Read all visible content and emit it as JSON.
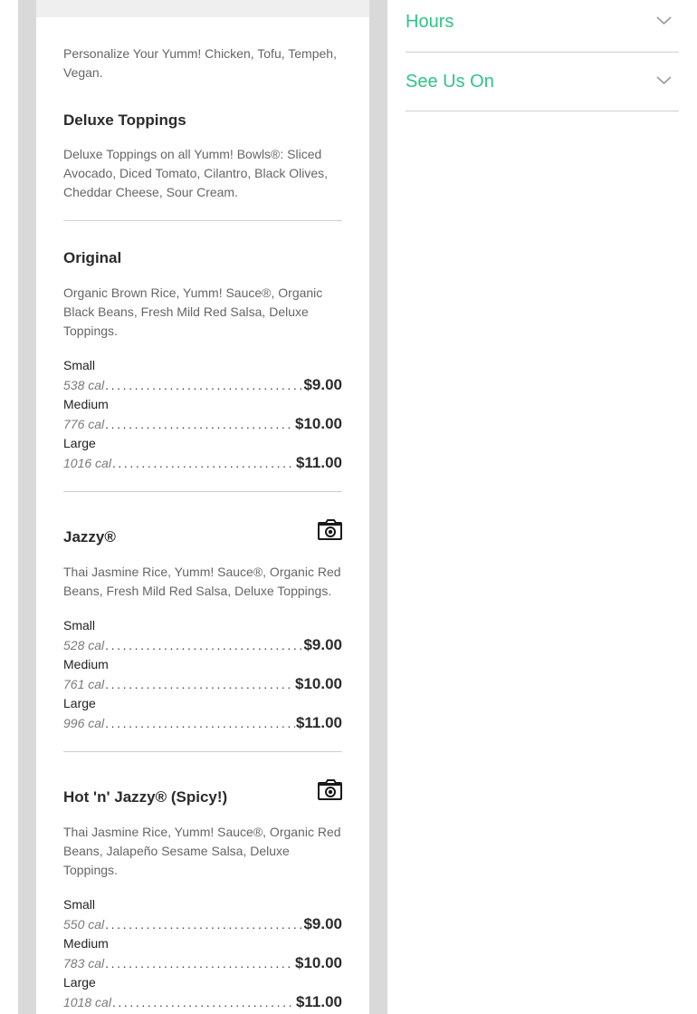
{
  "menu": {
    "intro": "Personalize Your Yumm! Chicken, Tofu, Tempeh, Vegan.",
    "toppings": {
      "title": "Deluxe Toppings",
      "description": "Deluxe Toppings on all Yumm! Bowls®: Sliced Avocado, Diced Tomato, Cilantro, Black Olives, Cheddar Cheese, Sour Cream."
    },
    "items": [
      {
        "name": "Original",
        "description": "Organic Brown Rice, Yumm! Sauce®, Organic Black Beans, Fresh Mild Red Salsa, Deluxe Toppings.",
        "has_photo": false,
        "sizes": [
          {
            "label": "Small",
            "cal": "538 cal",
            "price": "$9.00"
          },
          {
            "label": "Medium",
            "cal": "776 cal",
            "price": "$10.00"
          },
          {
            "label": "Large",
            "cal": "1016 cal",
            "price": "$11.00"
          }
        ]
      },
      {
        "name": "Jazzy®",
        "description": "Thai Jasmine Rice, Yumm! Sauce®, Organic Red Beans, Fresh Mild Red Salsa, Deluxe Toppings.",
        "has_photo": true,
        "sizes": [
          {
            "label": "Small",
            "cal": "528 cal",
            "price": "$9.00"
          },
          {
            "label": "Medium",
            "cal": "761 cal",
            "price": "$10.00"
          },
          {
            "label": "Large",
            "cal": "996 cal",
            "price": "$11.00"
          }
        ]
      },
      {
        "name": "Hot 'n' Jazzy® (Spicy!)",
        "description": "Thai Jasmine Rice, Yumm! Sauce®, Organic Red Beans, Jalapeño Sesame Salsa, Deluxe Toppings.",
        "has_photo": true,
        "sizes": [
          {
            "label": "Small",
            "cal": "550 cal",
            "price": "$9.00"
          },
          {
            "label": "Medium",
            "cal": "783 cal",
            "price": "$10.00"
          },
          {
            "label": "Large",
            "cal": "1018 cal",
            "price": "$11.00"
          }
        ]
      }
    ]
  },
  "sidebar": {
    "accordions": [
      {
        "label": "Hours",
        "icon": "chevron-down-icon"
      },
      {
        "label": "See Us On",
        "icon": "chevron-down-icon"
      }
    ]
  },
  "colors": {
    "accent": "#2fc486",
    "gutter": "#d9d9d9"
  }
}
